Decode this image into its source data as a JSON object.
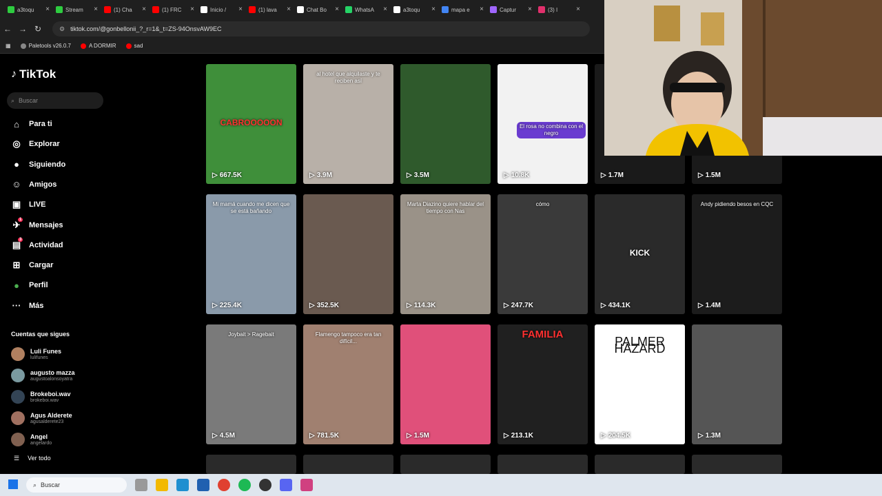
{
  "browser": {
    "tabs": [
      {
        "title": "a3toqu",
        "color": "#2ecc40"
      },
      {
        "title": "Stream",
        "color": "#2ecc40"
      },
      {
        "title": "(1) Cha",
        "color": "#ff0000"
      },
      {
        "title": "(1) FRC",
        "color": "#ff0000"
      },
      {
        "title": "Inicio /",
        "color": "#ffffff"
      },
      {
        "title": "(1) lava",
        "color": "#ff0000"
      },
      {
        "title": "Chat Bo",
        "color": "#ffffff"
      },
      {
        "title": "WhatsA",
        "color": "#25d366"
      },
      {
        "title": "a3toqu",
        "color": "#ffffff"
      },
      {
        "title": "mapa e",
        "color": "#4285f4"
      },
      {
        "title": "Captur",
        "color": "#a066ff"
      },
      {
        "title": "(3) I",
        "color": "#e1306c"
      }
    ],
    "url": "tiktok.com/@gonbellonii_?_r=1&_t=ZS-94OnsvAW9EC",
    "bookmarks": [
      "Paletools v26.0.7",
      "A DORMIR",
      "sad"
    ]
  },
  "sidebar": {
    "logo": "TikTok",
    "search_placeholder": "Buscar",
    "nav": [
      {
        "label": "Para ti",
        "icon": "home-icon"
      },
      {
        "label": "Explorar",
        "icon": "compass-icon"
      },
      {
        "label": "Siguiendo",
        "icon": "following-avatar-icon"
      },
      {
        "label": "Amigos",
        "icon": "friends-icon"
      },
      {
        "label": "LIVE",
        "icon": "live-icon"
      },
      {
        "label": "Mensajes",
        "icon": "messages-icon",
        "badge": "1"
      },
      {
        "label": "Actividad",
        "icon": "activity-icon",
        "badge": "3"
      },
      {
        "label": "Cargar",
        "icon": "upload-icon"
      },
      {
        "label": "Perfil",
        "icon": "profile-icon"
      },
      {
        "label": "Más",
        "icon": "more-icon"
      }
    ],
    "following_title": "Cuentas que sigues",
    "following": [
      {
        "name": "Luli Funes",
        "handle": "lulifunes",
        "color": "#b08060"
      },
      {
        "name": "augusto mazza",
        "handle": "augustoalonsoyatra",
        "color": "#7a9aa0"
      },
      {
        "name": "Brokeboi.wav",
        "handle": "brokeboi.wav",
        "color": "#334455"
      },
      {
        "name": "Agus Alderete",
        "handle": "agusalderete23",
        "color": "#a07060"
      },
      {
        "name": "Angel",
        "handle": "angelardo",
        "color": "#806050"
      }
    ],
    "see_all": "Ver todo"
  },
  "videos": [
    {
      "views": "667.5K",
      "caption": "CABROOOOON",
      "bg": "#3f8f3a"
    },
    {
      "views": "3.9M",
      "caption": "al hotel que alquilaste y te reciben así",
      "bg": "#b8b0a8"
    },
    {
      "views": "3.5M",
      "caption": "",
      "bg": "#2f5a2c"
    },
    {
      "views": "10.8K",
      "caption": "El rosa no combina con el negro",
      "bg": "#f2f2f2"
    },
    {
      "views": "1.7M",
      "caption": "",
      "bg": "#1a1a1a"
    },
    {
      "views": "1.5M",
      "caption": "",
      "bg": "#1a1a1a"
    },
    {
      "views": "225.4K",
      "caption": "Mi mamá cuando me dicen que se está bañando",
      "bg": "#8a9aaa"
    },
    {
      "views": "352.5K",
      "caption": "",
      "bg": "#6a5a50"
    },
    {
      "views": "114.3K",
      "caption": "Marta Diazino quiere hablar del tiempo con Nas",
      "bg": "#9a9288"
    },
    {
      "views": "247.7K",
      "caption": "cómo",
      "bg": "#3a3a3a"
    },
    {
      "views": "434.1K",
      "caption": "KICK",
      "bg": "#2a2a2a"
    },
    {
      "views": "1.4M",
      "caption": "Andy pidiendo besos en CQC",
      "bg": "#1c1c1c"
    },
    {
      "views": "4.5M",
      "caption": "Joybait > Ragebait",
      "bg": "#7a7a7a"
    },
    {
      "views": "781.5K",
      "caption": "Flamengo tampoco era tan difícil...",
      "bg": "#a08070"
    },
    {
      "views": "1.5M",
      "caption": "",
      "bg": "#e0507a"
    },
    {
      "views": "213.1K",
      "caption": "FAMILIA",
      "bg": "#202020"
    },
    {
      "views": "204.5K",
      "caption": "PALMER HAZARD",
      "bg": "#ffffff"
    },
    {
      "views": "1.3M",
      "caption": "",
      "bg": "#555555"
    }
  ],
  "taskbar": {
    "search_placeholder": "Buscar"
  }
}
